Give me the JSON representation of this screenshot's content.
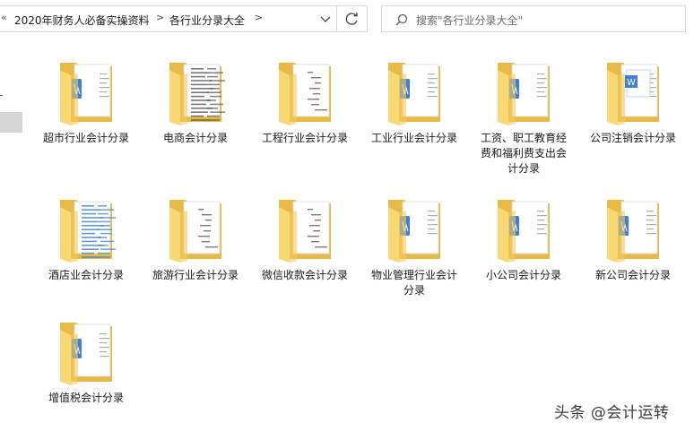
{
  "breadcrumb": {
    "back_chevron": "«",
    "items": [
      "2020年财务人必备实操资料",
      "各行业分录大全"
    ],
    "separator": ">"
  },
  "search": {
    "placeholder": "搜索\"各行业分录大全\""
  },
  "folders": [
    {
      "label": "超市行业会计分录",
      "style": "word"
    },
    {
      "label": "电商会计分录",
      "style": "dense"
    },
    {
      "label": "工程行业会计分录",
      "style": "doc"
    },
    {
      "label": "工业行业会计分录",
      "style": "word"
    },
    {
      "label": "工资、职工教育经费和福利费支出会计分录",
      "style": "word"
    },
    {
      "label": "公司注销会计分录",
      "style": "wordbig"
    },
    {
      "label": "酒店业会计分录",
      "style": "table"
    },
    {
      "label": "旅游行业会计分录",
      "style": "doc"
    },
    {
      "label": "微信收款会计分录",
      "style": "doc"
    },
    {
      "label": "物业管理行业会计分录",
      "style": "word"
    },
    {
      "label": "小公司会计分录",
      "style": "word"
    },
    {
      "label": "新公司会计分录",
      "style": "word"
    },
    {
      "label": "增值税会计分录",
      "style": "word"
    }
  ],
  "watermark": "头条 @会计运转",
  "colors": {
    "folder_back": "#e8b944",
    "folder_front": "#f8d775",
    "word_blue": "#3f7fd8"
  }
}
